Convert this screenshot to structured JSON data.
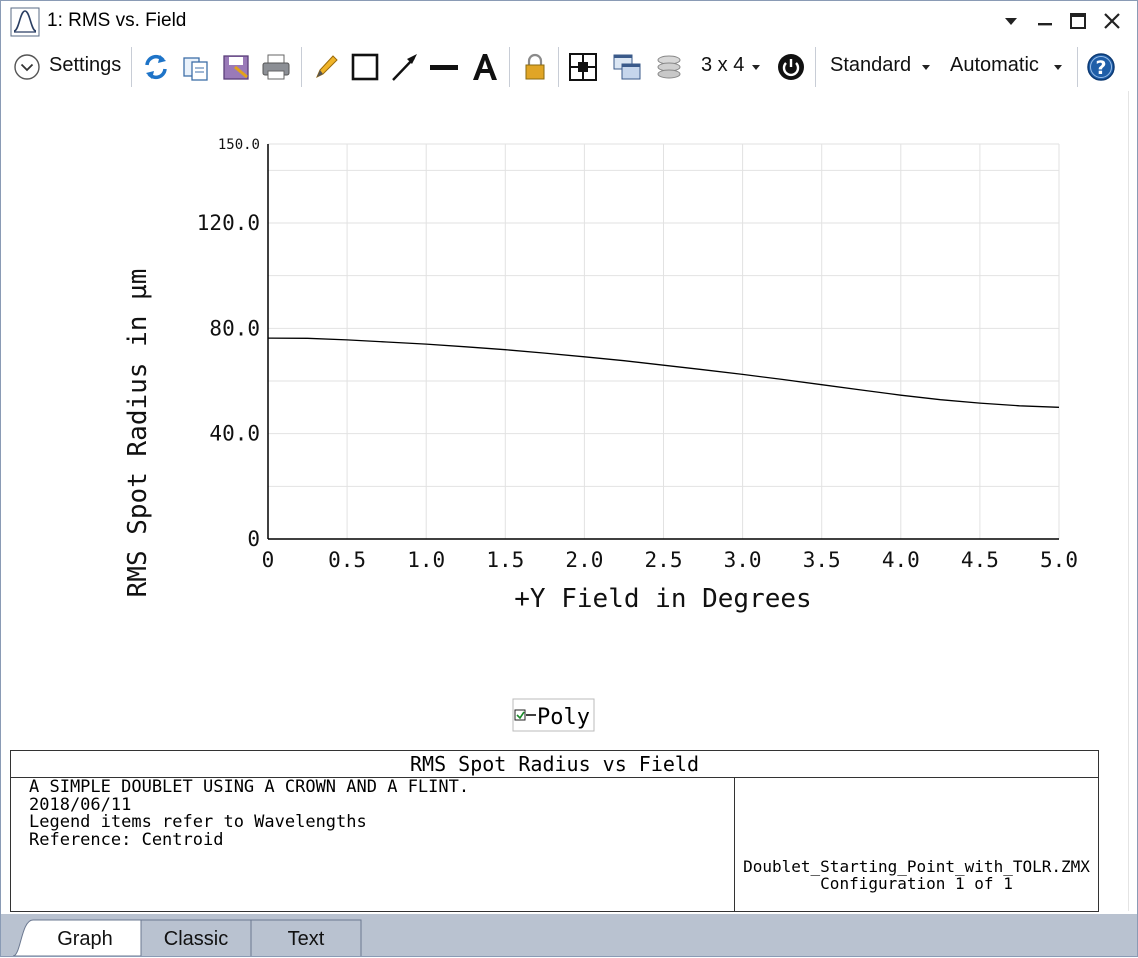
{
  "window": {
    "title": "1: RMS vs. Field"
  },
  "toolbar": {
    "settings_label": "Settings",
    "layout_label": "3 x 4",
    "standard_label": "Standard",
    "automatic_label": "Automatic",
    "icons": [
      "refresh-icon",
      "copy-icon",
      "save-icon",
      "print-icon",
      "pencil-icon",
      "rectangle-icon",
      "arrow-icon",
      "line-icon",
      "text-icon",
      "lock-icon",
      "grid-icon",
      "windows-icon",
      "layers-icon",
      "power-icon",
      "help-icon"
    ]
  },
  "chart_data": {
    "type": "line",
    "title": "",
    "xlabel": "+Y Field in Degrees",
    "ylabel": "RMS Spot Radius in µm",
    "xlim": [
      0,
      5.0
    ],
    "ylim": [
      0,
      150.0
    ],
    "x_ticks": [
      0,
      0.5,
      1.0,
      1.5,
      2.0,
      2.5,
      3.0,
      3.5,
      4.0,
      4.5,
      5.0
    ],
    "x_tick_labels": [
      "0",
      "0.5",
      "1.0",
      "1.5",
      "2.0",
      "2.5",
      "3.0",
      "3.5",
      "4.0",
      "4.5",
      "5.0"
    ],
    "y_ticks": [
      0,
      40.0,
      80.0,
      120.0,
      150.0
    ],
    "y_tick_labels": [
      "0",
      "40.0",
      "80.0",
      "120.0",
      "150.0"
    ],
    "grid": true,
    "legend_position": "bottom-center",
    "series": [
      {
        "name": "Poly",
        "color": "#000000",
        "x": [
          0,
          0.25,
          0.5,
          0.75,
          1.0,
          1.25,
          1.5,
          1.75,
          2.0,
          2.25,
          2.5,
          2.75,
          3.0,
          3.25,
          3.5,
          3.75,
          4.0,
          4.25,
          4.5,
          4.75,
          5.0
        ],
        "values": [
          76.3,
          76.2,
          75.6,
          74.8,
          74.0,
          73.0,
          71.9,
          70.6,
          69.2,
          67.7,
          66.0,
          64.3,
          62.5,
          60.6,
          58.6,
          56.6,
          54.6,
          52.9,
          51.6,
          50.6,
          50.0
        ]
      }
    ]
  },
  "info": {
    "title": "RMS Spot Radius vs Field",
    "lines": [
      "A SIMPLE DOUBLET USING A CROWN AND A FLINT.",
      "2018/06/11",
      "Legend items refer to Wavelengths",
      "Reference: Centroid"
    ],
    "file_name": "Doublet_Starting_Point_with_TOLR.ZMX",
    "configuration": "Configuration 1 of 1"
  },
  "tabs": [
    {
      "label": "Graph",
      "active": true
    },
    {
      "label": "Classic",
      "active": false
    },
    {
      "label": "Text",
      "active": false
    }
  ]
}
